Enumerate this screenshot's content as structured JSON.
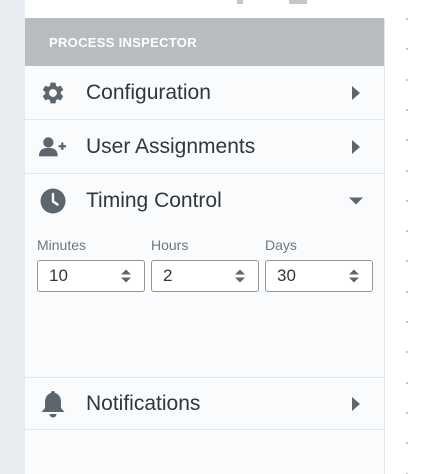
{
  "panel": {
    "title": "PROCESS INSPECTOR"
  },
  "sections": {
    "configuration": {
      "label": "Configuration",
      "icon": "gear-icon",
      "expanded": false
    },
    "user_assignments": {
      "label": "User Assignments",
      "icon": "user-plus-icon",
      "expanded": false
    },
    "timing_control": {
      "label": "Timing Control",
      "icon": "clock-icon",
      "expanded": true
    },
    "notifications": {
      "label": "Notifications",
      "icon": "bell-icon",
      "expanded": false
    }
  },
  "timing": {
    "minutes": {
      "label": "Minutes",
      "value": "10"
    },
    "hours": {
      "label": "Hours",
      "value": "2"
    },
    "days": {
      "label": "Days",
      "value": "30"
    }
  },
  "colors": {
    "header_bg": "#b7bcc1",
    "icon": "#5d666e",
    "text": "#2d3740",
    "muted": "#6e7780"
  }
}
